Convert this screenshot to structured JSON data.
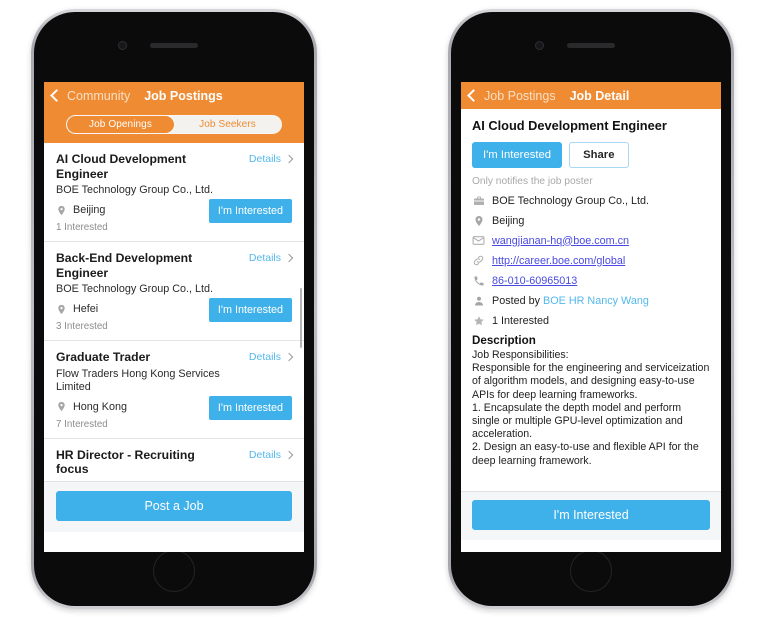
{
  "listing_screen": {
    "nav": {
      "back_label": "Community",
      "title": "Job Postings"
    },
    "segmented": {
      "options": [
        "Job Openings",
        "Job Seekers"
      ],
      "selected": "Job Openings"
    },
    "details_label": "Details",
    "interested_label": "I'm Interested",
    "jobs": [
      {
        "title": "AI Cloud Development Engineer",
        "company": "BOE Technology Group Co., Ltd.",
        "location": "Beijing",
        "interested": "1 Interested"
      },
      {
        "title": "Back-End Development Engineer",
        "company": "BOE Technology Group Co., Ltd.",
        "location": "Hefei",
        "interested": "3 Interested"
      },
      {
        "title": "Graduate Trader",
        "company": "Flow Traders Hong Kong Services Limited",
        "location": "Hong Kong",
        "interested": "7 Interested"
      },
      {
        "title": "HR Director - Recruiting focus",
        "company": "",
        "location": "",
        "interested": ""
      }
    ],
    "post_button": "Post a Job"
  },
  "detail_screen": {
    "nav": {
      "back_label": "Job Postings",
      "title": "Job Detail"
    },
    "title": "AI Cloud Development Engineer",
    "interested_button": "I'm Interested",
    "share_button": "Share",
    "note": "Only notifies the job poster",
    "company": "BOE Technology Group Co., Ltd.",
    "location": "Beijing",
    "email": "wangjianan-hq@boe.com.cn",
    "website": "http://career.boe.com/global",
    "phone": "86-010-60965013",
    "posted_by_prefix": "Posted by",
    "posted_by_name": "BOE HR Nancy Wang",
    "interested_count": "1 Interested",
    "description_heading": "Description",
    "description_body": "Job Responsibilities:\nResponsible for the engineering and serviceization of algorithm models, and designing easy-to-use APIs for deep learning frameworks.\n1. Encapsulate the depth model and perform single or multiple GPU-level optimization and acceleration.\n2. Design an easy-to-use and flexible API for the deep learning framework.",
    "bottom_button": "I'm Interested"
  },
  "colors": {
    "brand_orange": "#ef8b33",
    "accent_blue": "#3fb1ea",
    "link_blue": "#4a4ae0",
    "link_cyan": "#53b8ec"
  }
}
